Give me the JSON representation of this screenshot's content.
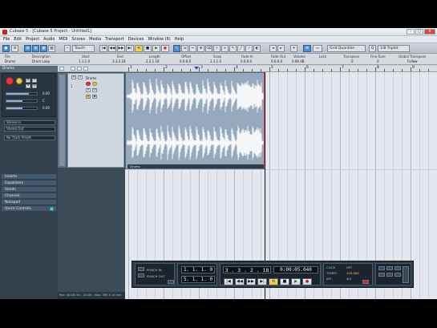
{
  "window": {
    "title": "Cubase 5 - [Cubase 5 Project - Untitled1]",
    "controls": [
      "–",
      "□",
      "×"
    ]
  },
  "menu": [
    "File",
    "Edit",
    "Project",
    "Audio",
    "MIDI",
    "Scores",
    "Media",
    "Transport",
    "Devices",
    "Window (6)",
    "Help"
  ],
  "toolbar": {
    "mode": "Touch",
    "quantize": "Grid Quantize",
    "grid_type": "1/8 Triplet",
    "transport_buttons": [
      "|◀",
      "◀◀",
      "▶▶",
      "▶|",
      "⟲",
      "■",
      "▶",
      "●"
    ]
  },
  "info_line": {
    "headers": [
      "File",
      "Description",
      "Start",
      "End",
      "Length",
      "Offset",
      "Snap",
      "Fade-In",
      "Fade-Out",
      "Volume",
      "Lock",
      "Transpose",
      "Fine-Tune",
      "Global Transpose"
    ],
    "values": [
      "Drums",
      "Drum Loop",
      "1.1.1.0",
      "3.3.2.18",
      "2.2.1.18",
      "0.0.0.0",
      "1.1.1.0",
      "0.0.0.0",
      "0.0.0.0",
      "0.00 dB",
      "",
      "0",
      "0",
      "Follow"
    ]
  },
  "inspector": {
    "track_name": "Drums",
    "volume": "0.00",
    "pan": "C",
    "delay": "0.00",
    "sections": [
      "Inserts",
      "Equalizers",
      "Sends",
      "Channel",
      "Notepad",
      "Quick Controls"
    ],
    "routing": [
      "Stereo In",
      "Stereo Out"
    ],
    "fx_field": "No Track Preset"
  },
  "track": {
    "name": "Drums",
    "number": "1",
    "buttons": [
      "M",
      "S",
      "R",
      "W",
      "e"
    ]
  },
  "ruler": {
    "bars": [
      "1",
      "2",
      "3",
      "4",
      "5",
      "6",
      "7",
      "8",
      "9"
    ]
  },
  "event": {
    "name": "Drums"
  },
  "transport": {
    "position_primary": "3 . 3 . 2 . 18",
    "position_secondary": "0:00:05.040",
    "left_locator": "1. 1. 1. 0",
    "right_locator": "5. 1. 1. 0",
    "tempo": "120.000",
    "signature": "4/4",
    "sync": "INT",
    "click": "CLICK",
    "tempo_label": "TEMPO",
    "offline": "OFF",
    "punch_in": "PUNCH IN",
    "punch_out": "PUNCH OUT"
  },
  "statusbar": {
    "text": "Rec: 44100 Hz - 24 Bit - Max: 390 h 10 min"
  }
}
